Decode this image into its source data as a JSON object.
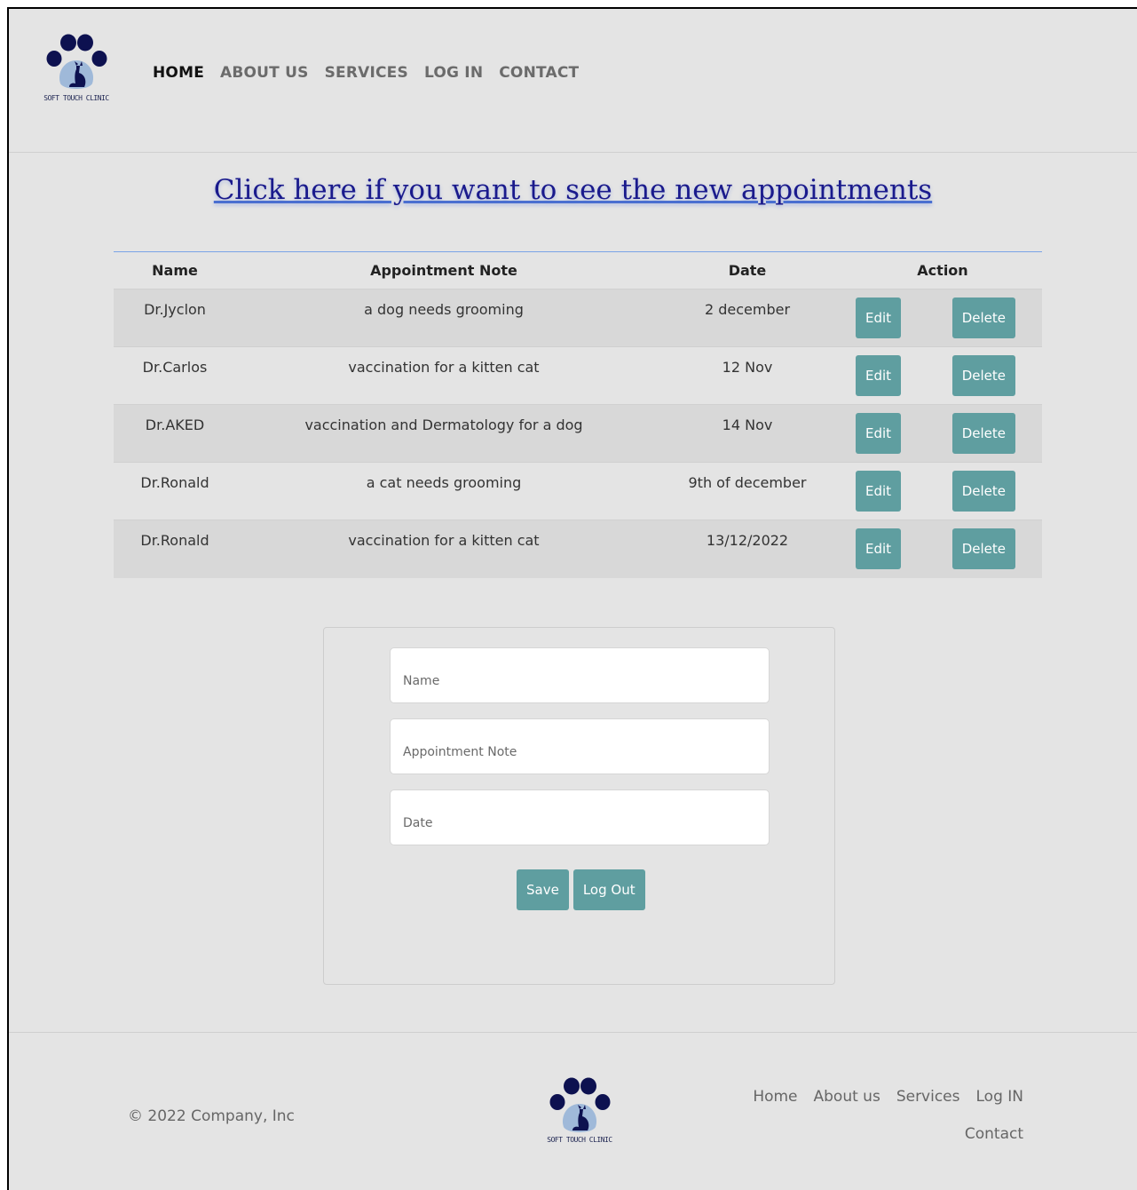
{
  "header": {
    "logo_text": "SOFT TOUCH CLINIC",
    "nav": [
      "HOME",
      "ABOUT US",
      "SERVICES",
      "LOG IN",
      "CONTACT"
    ],
    "active_nav": "HOME"
  },
  "link_text": "Click here if you want to see the new appointments",
  "table": {
    "headers": [
      "Name",
      "Appointment Note",
      "Date",
      "Action"
    ],
    "rows": [
      {
        "name": "Dr.Jyclon",
        "note": "a dog needs grooming",
        "date": "2 december"
      },
      {
        "name": "Dr.Carlos",
        "note": "vaccination for a kitten cat",
        "date": "12 Nov"
      },
      {
        "name": "Dr.AKED",
        "note": "vaccination and Dermatology for a dog",
        "date": "14 Nov"
      },
      {
        "name": "Dr.Ronald",
        "note": "a cat needs grooming",
        "date": "9th of december"
      },
      {
        "name": "Dr.Ronald",
        "note": "vaccination for a kitten cat",
        "date": "13/12/2022"
      }
    ],
    "edit_label": "Edit",
    "delete_label": "Delete"
  },
  "form": {
    "name_placeholder": "Name",
    "note_placeholder": "Appointment Note",
    "date_placeholder": "Date",
    "save_label": "Save",
    "logout_label": "Log Out"
  },
  "footer": {
    "copyright": "© 2022 Company, Inc",
    "logo_text": "SOFT TOUCH CLINIC",
    "links": [
      "Home",
      "About us",
      "Services",
      "Log IN",
      "Contact"
    ]
  },
  "colors": {
    "button": "#5f9ea0",
    "background": "#e4e4e4",
    "row_alt": "#d8d8d8",
    "link": "#1a1a8c",
    "logo_dark": "#0d1150",
    "logo_light": "#9fb9d9"
  },
  "icons": [
    "paw-cat-logo-icon"
  ]
}
